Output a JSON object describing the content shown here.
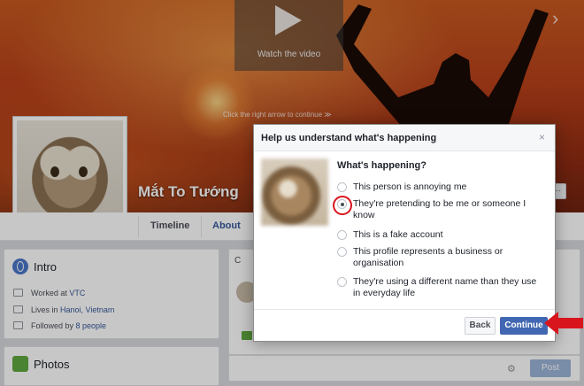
{
  "cover": {
    "video_label": "Watch the video",
    "arrow_hint": "Click the right arrow to continue ≫"
  },
  "profile": {
    "name": "Mắt To Tướng",
    "like_label": "···"
  },
  "nav": {
    "tabs": [
      "Timeline",
      "About"
    ]
  },
  "intro": {
    "title": "Intro",
    "work_prefix": "Worked at ",
    "work_value": "VTC",
    "lives_prefix": "Lives in ",
    "lives_value": "Hanoi, Vietnam",
    "followed_prefix": "Followed by ",
    "followed_value": "8 people"
  },
  "photos": {
    "title": "Photos"
  },
  "composer": {
    "tab_label": "C",
    "post_label": "Post"
  },
  "dialog": {
    "title": "Help us understand what's happening",
    "close_label": "×",
    "question": "What's happening?",
    "options": [
      "This person is annoying me",
      "They're pretending to be me or someone I know",
      "This is a fake account",
      "This profile represents a business or organisation",
      "They're using a different name than they use in everyday life"
    ],
    "selected_index": 1,
    "back_label": "Back",
    "continue_label": "Continue"
  },
  "colors": {
    "accent": "#4267b2",
    "highlight": "#d8151d"
  }
}
